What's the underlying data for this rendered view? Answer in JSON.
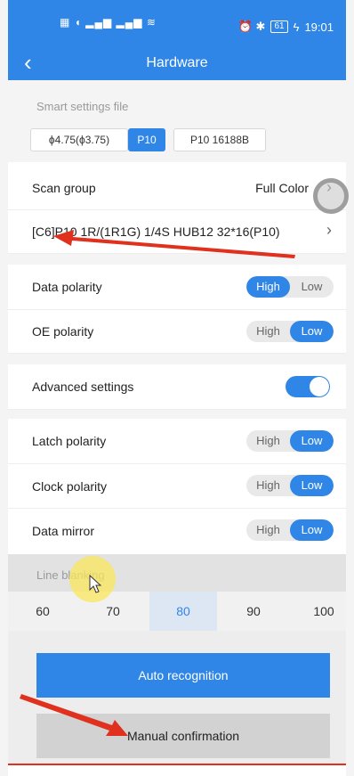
{
  "status_bar": {
    "left_icons": "▦ ◖ ▂▄▆ ▂▄▆ ≋",
    "clock": "19:01",
    "battery": "61",
    "status_icons": "⏰ ✱"
  },
  "nav": {
    "back_glyph": "‹",
    "title": "Hardware"
  },
  "smart_settings": {
    "title": "Smart settings file",
    "chips": [
      {
        "label": "ϕ4.75(ϕ3.75)",
        "active": false
      },
      {
        "label": "P10",
        "active": true
      },
      {
        "label": "P10 16188B",
        "active": false
      }
    ]
  },
  "scan_group": {
    "label": "Scan group",
    "value": "Full Color",
    "chevron": "›"
  },
  "module_row": {
    "value": "[C6]P10 1R/(1R1G) 1/4S HUB12 32*16(P10)",
    "chevron": "›"
  },
  "polarity": {
    "data": {
      "label": "Data polarity",
      "high": "High",
      "low": "Low",
      "selected": "High"
    },
    "oe": {
      "label": "OE polarity",
      "high": "High",
      "low": "Low",
      "selected": "Low"
    }
  },
  "advanced": {
    "label": "Advanced settings",
    "enabled": true
  },
  "advanced_rows": {
    "latch": {
      "label": "Latch polarity",
      "high": "High",
      "low": "Low",
      "selected": "Low"
    },
    "clock": {
      "label": "Clock polarity",
      "high": "High",
      "low": "Low",
      "selected": "Low"
    },
    "mirror": {
      "label": "Data mirror",
      "high": "High",
      "low": "Low",
      "selected": "Low"
    }
  },
  "line_blanking": {
    "title": "Line blanking",
    "values": [
      "60",
      "70",
      "80",
      "90",
      "100"
    ],
    "selected": "80"
  },
  "buttons": {
    "auto": "Auto recognition",
    "manual": "Manual confirmation"
  },
  "colors": {
    "accent": "#2f86e6",
    "annotation_red": "#e0301e"
  }
}
